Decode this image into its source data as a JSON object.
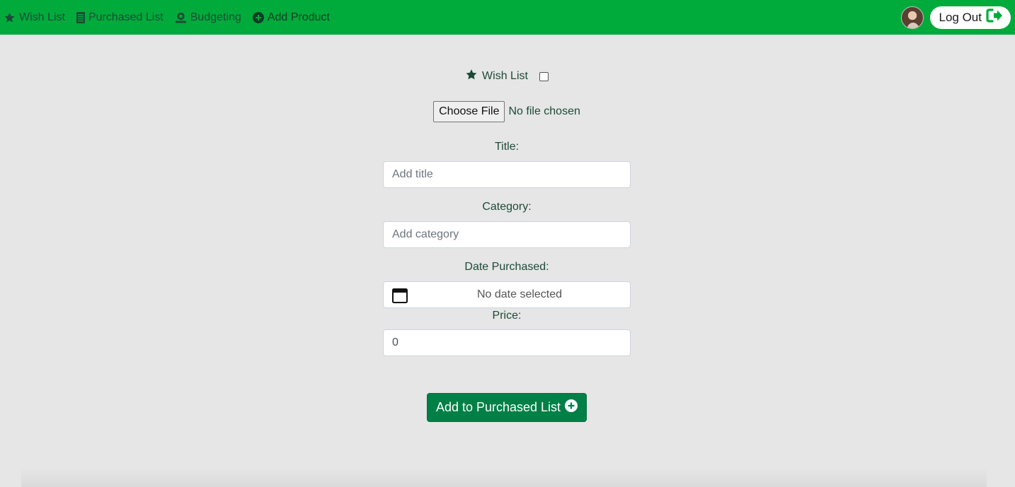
{
  "nav": {
    "items": [
      {
        "label": "Wish List",
        "icon": "star-icon"
      },
      {
        "label": "Purchased List",
        "icon": "list-icon"
      },
      {
        "label": "Budgeting",
        "icon": "budget-icon"
      },
      {
        "label": "Add Product",
        "icon": "plus-circle-icon"
      }
    ],
    "logout_label": "Log Out"
  },
  "form": {
    "wish_list_label": "Wish List",
    "choose_file_label": "Choose File",
    "file_status": "No file chosen",
    "title_label": "Title:",
    "title_placeholder": "Add title",
    "category_label": "Category:",
    "category_placeholder": "Add category",
    "date_label": "Date Purchased:",
    "date_value": "No date selected",
    "price_label": "Price:",
    "price_value": "0",
    "submit_label": "Add to Purchased List"
  },
  "colors": {
    "navbar": "#00ab3b",
    "background": "#e6e6e6",
    "button": "#008046",
    "text": "#1d4a36"
  }
}
